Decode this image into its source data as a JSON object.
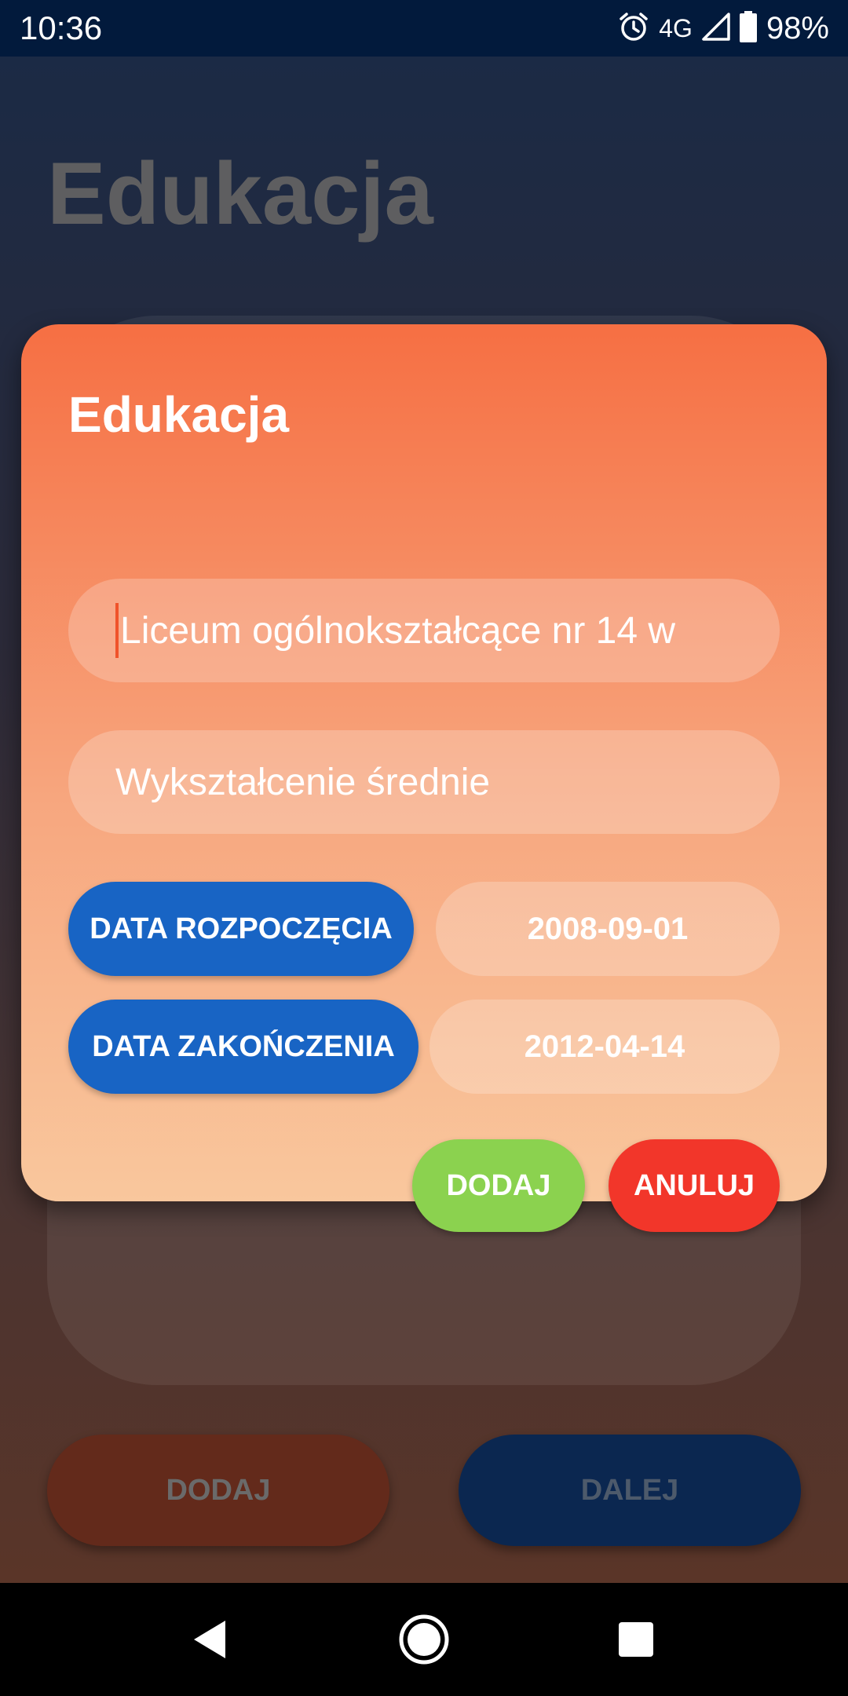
{
  "status_bar": {
    "time": "10:36",
    "network": "4G",
    "battery": "98%",
    "icons": [
      "alarm-icon",
      "signal-icon",
      "battery-icon"
    ]
  },
  "background_screen": {
    "title": "Edukacja",
    "buttons": {
      "add": "DODAJ",
      "next": "DALEJ"
    }
  },
  "dialog": {
    "title": "Edukacja",
    "school_field": {
      "value": "Liceum ogólnokształcące nr 14 w"
    },
    "degree_field": {
      "value": "Wykształcenie średnie"
    },
    "start_date": {
      "button_label": "DATA ROZPOCZĘCIA",
      "value": "2008-09-01"
    },
    "end_date": {
      "button_label": "DATA ZAKOŃCZENIA",
      "value": "2012-04-14"
    },
    "actions": {
      "add": "DODAJ",
      "cancel": "ANULUJ"
    }
  },
  "nav_bar": {
    "icons": [
      "back-icon",
      "home-icon",
      "recents-icon"
    ]
  },
  "colors": {
    "dialog_top": "#f66f43",
    "dialog_bottom": "#f9c79d",
    "date_button": "#1864c4",
    "add_button": "#8bd24f",
    "cancel_button": "#f2362a",
    "status_bar": "#021a3c"
  }
}
